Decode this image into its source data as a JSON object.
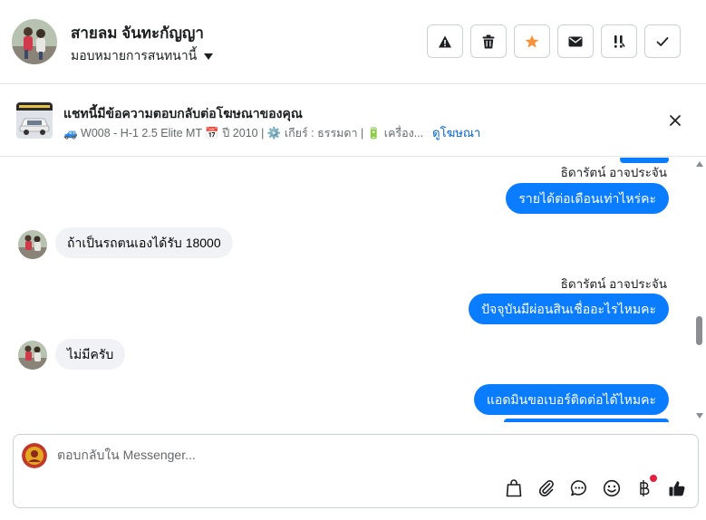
{
  "header": {
    "contact_name": "สายลม จันทะกัญญา",
    "assign_label": "มอบหมายการสนทนานี้",
    "actions": [
      {
        "icon": "warning-icon"
      },
      {
        "icon": "trash-icon"
      },
      {
        "icon": "star-icon",
        "color": "#f7923b"
      },
      {
        "icon": "envelope-icon"
      },
      {
        "icon": "follow-up-icon"
      },
      {
        "icon": "checkmark-icon"
      }
    ]
  },
  "ad_banner": {
    "title": "แชทนี้มีข้อความตอบกลับต่อโฆษณาของคุณ",
    "details": "🚙 W008 - H-1 2.5 Elite MT 📅 ปี 2010 | ⚙️ เกียร์ : ธรรมดา | 🔋 เครื่อง...",
    "view_ad_link": "ดูโฆษณา"
  },
  "messages": [
    {
      "sender": "ธิดารัตน์ อาจประจัน",
      "text": "รายได้ต่อเดือนเท่าไหร่คะ",
      "direction": "outgoing"
    },
    {
      "text": "ถ้าเป็นรถตนเองได้รับ 18000",
      "direction": "incoming"
    },
    {
      "sender": "ธิดารัตน์ อาจประจัน",
      "text": "ปัจจุบันมีผ่อนสินเชื่ออะไรไหมคะ",
      "direction": "outgoing"
    },
    {
      "text": "ไม่มีครับ",
      "direction": "incoming"
    },
    {
      "text": "แอดมินขอเบอร์ติดต่อได้ไหมคะ",
      "direction": "outgoing"
    }
  ],
  "composer": {
    "placeholder": "ตอบกลับใน Messenger...",
    "tools": [
      "shopping-bag-icon",
      "paperclip-icon",
      "saved-reply-icon",
      "emoji-icon",
      "baht-icon",
      "thumbs-up-icon"
    ]
  },
  "colors": {
    "accent": "#0a7cff",
    "incoming_bubble": "#f0f2f5",
    "notification_dot": "#e41e3f",
    "link": "#0064d1"
  }
}
